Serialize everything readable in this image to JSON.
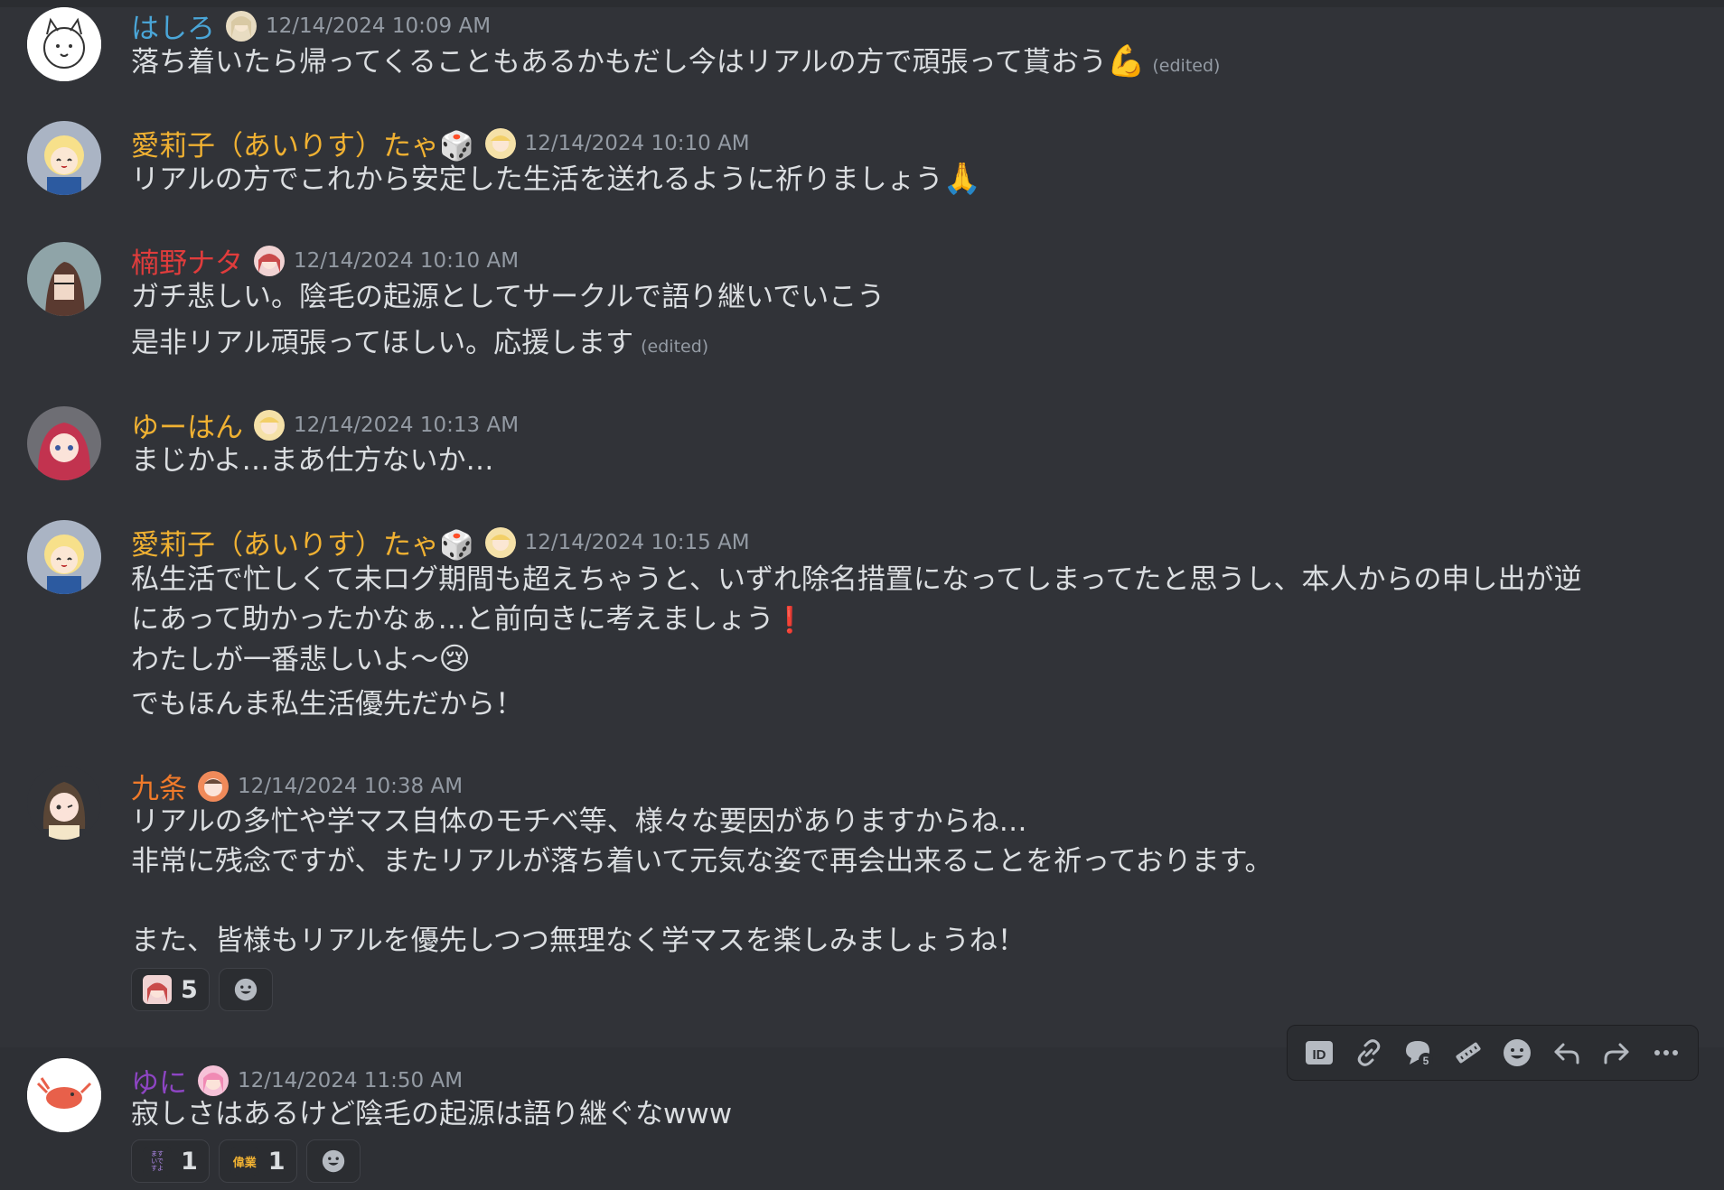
{
  "colors": {
    "background": "#313338",
    "text": "#dbdee1",
    "muted": "#949ba4",
    "name_blue": "#4aa6d8",
    "name_gold": "#f0b132",
    "name_red": "#e03c3c",
    "name_orange": "#f07a2a",
    "name_purple": "#8e45c4"
  },
  "messages": [
    {
      "username": "はしろ",
      "timestamp": "12/14/2024 10:09 AM",
      "lines": [
        "落ち着いたら帰ってくることもあるかもだし今はリアルの方で頑張って貰おう"
      ],
      "emoji": "💪",
      "edited": "(edited)"
    },
    {
      "username": "愛莉子（あいりす）たゃ🎲",
      "timestamp": "12/14/2024 10:10 AM",
      "lines": [
        "リアルの方でこれから安定した生活を送れるように祈りましょう"
      ],
      "emoji": "🙏"
    },
    {
      "username": "楠野ナタ",
      "timestamp": "12/14/2024 10:10 AM",
      "lines": [
        "ガチ悲しい。陰毛の起源としてサークルで語り継いでいこう",
        "是非リアル頑張ってほしい。応援します"
      ],
      "edited": "(edited)"
    },
    {
      "username": "ゆーはん",
      "timestamp": "12/14/2024 10:13 AM",
      "lines": [
        "まじかよ…まあ仕方ないか…"
      ]
    },
    {
      "username": "愛莉子（あいりす）たゃ🎲",
      "timestamp": "12/14/2024 10:15 AM",
      "lines": [
        "私生活で忙しくて未ログ期間も超えちゃうと、いずれ除名措置になってしまってたと思うし、本人からの申し出が逆",
        "にあって助かったかなぁ…と前向きに考えましょう",
        "わたしが一番悲しいよ〜",
        "でもほんま私生活優先だから！"
      ],
      "emoji_exclaim": "❗",
      "emoji_cry": "😢"
    },
    {
      "username": "九条",
      "timestamp": "12/14/2024 10:38 AM",
      "lines": [
        "リアルの多忙や学マス自体のモチベ等、様々な要因がありますからね…",
        "非常に残念ですが、またリアルが落ち着いて元気な姿で再会出来ることを祈っております。",
        "また、皆様もリアルを優先しつつ無理なく学マスを楽しみましょうね！"
      ],
      "reactions": [
        {
          "count": "5"
        }
      ]
    },
    {
      "username": "ゆに",
      "timestamp": "12/14/2024 11:50 AM",
      "lines": [
        "寂しさはあるけど陰毛の起源は語り継ぐなwww"
      ],
      "reactions": [
        {
          "label": "ますいですよ",
          "count": "1"
        },
        {
          "label": "偉業",
          "count": "1"
        }
      ]
    }
  ],
  "hover_toolbar": [
    "id-icon",
    "link-icon",
    "thread-reply-icon",
    "ruler-icon",
    "emoji-icon",
    "reply-icon",
    "forward-icon",
    "more-icon"
  ]
}
